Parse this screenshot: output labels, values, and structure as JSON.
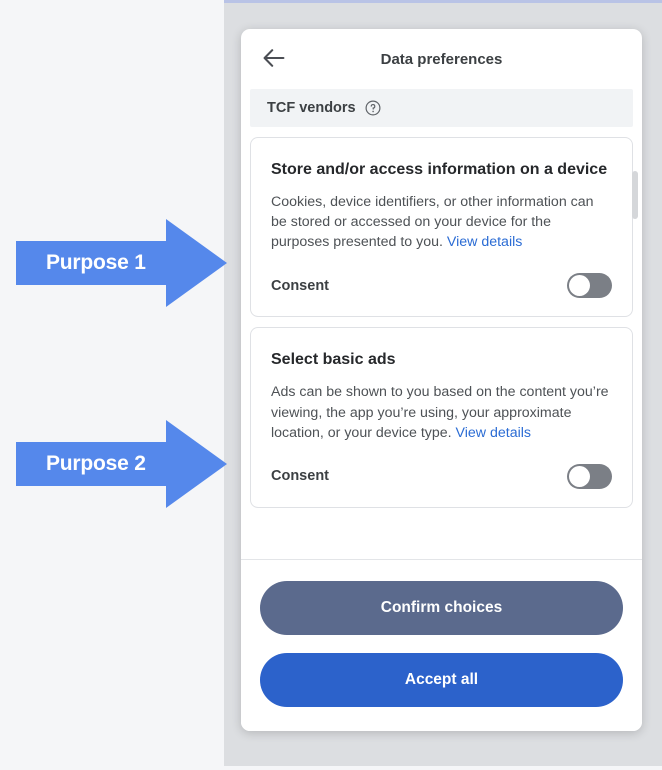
{
  "annotations": [
    {
      "label": "Purpose 1",
      "color": "#5588eb"
    },
    {
      "label": "Purpose 2",
      "color": "#5588eb"
    }
  ],
  "modal": {
    "back_icon": "arrow-left-icon",
    "title": "Data preferences",
    "section": {
      "label": "TCF vendors",
      "help_icon": "question-mark-circle-icon"
    },
    "purposes": [
      {
        "title": "Store and/or access information on a device",
        "description": "Cookies, device identifiers, or other information can be stored or accessed on your device for the purposes presented to you. ",
        "link_text": "View details",
        "consent_label": "Consent",
        "consent_on": false
      },
      {
        "title": "Select basic ads",
        "description": "Ads can be shown to you based on the content you’re viewing, the app you’re using, your approximate location, or your device type. ",
        "link_text": "View details",
        "consent_label": "Consent",
        "consent_on": false
      }
    ],
    "footer": {
      "confirm_label": "Confirm choices",
      "accept_label": "Accept all"
    }
  },
  "colors": {
    "accent_blue": "#2c62cb",
    "secondary_slate": "#5b6a8d",
    "link_blue": "#2b6cd4",
    "toggle_off": "#7b7f86",
    "arrow_blue": "#5588eb",
    "page_bg": "#f5f6f8",
    "backdrop_gray": "#dcdee1"
  }
}
